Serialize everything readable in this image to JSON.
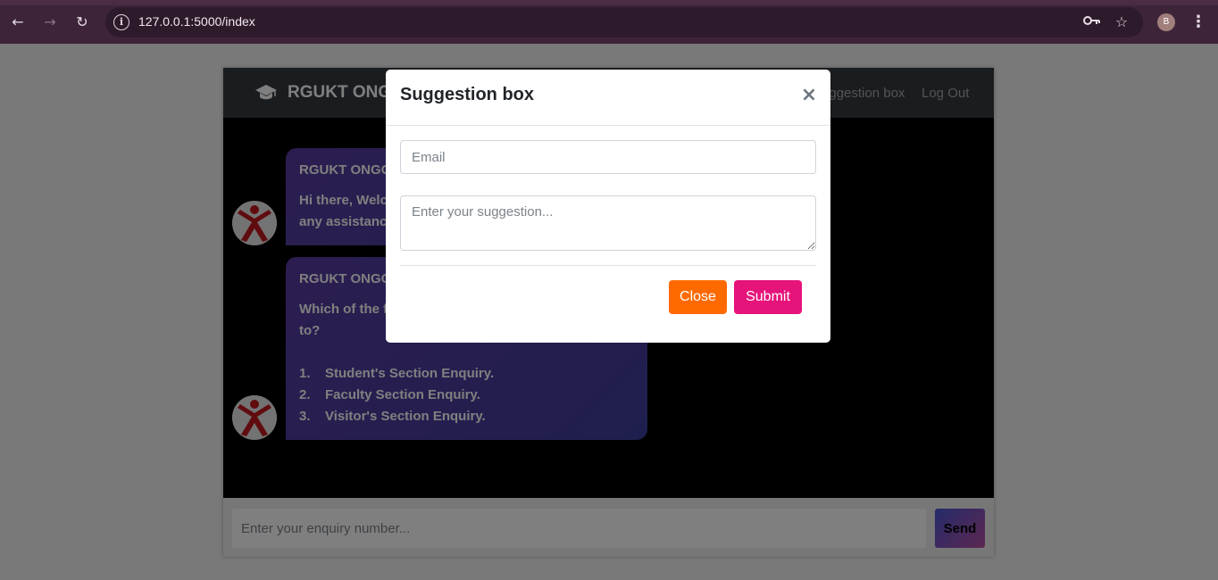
{
  "browser": {
    "url": "127.0.0.1:5000/index",
    "profile_initial": "B",
    "icons": [
      "back-icon",
      "forward-icon",
      "reload-icon",
      "info-icon",
      "key-icon",
      "star-icon",
      "kebab-menu-icon"
    ]
  },
  "navbar": {
    "brand_icon": "graduation-cap-icon",
    "brand": "RGUKT ONGOLE",
    "links": [
      "Suggestion box",
      "Log Out"
    ]
  },
  "chat": {
    "messages": [
      {
        "sender": "RGUKT ONGOLE",
        "text": "Hi there, Welcome to RGUKT ONGOLE! If you need any assistance, I'm always here."
      },
      {
        "sender": "RGUKT ONGOLE",
        "text": "Which of the following user groups do you belong to?",
        "options": [
          {
            "num": "1.",
            "label": "Student's Section Enquiry."
          },
          {
            "num": "2.",
            "label": "Faculty Section Enquiry."
          },
          {
            "num": "3.",
            "label": "Visitor's Section Enquiry."
          }
        ]
      }
    ]
  },
  "input_bar": {
    "placeholder": "Enter your enquiry number...",
    "send_label": "Send"
  },
  "modal": {
    "title": "Suggestion box",
    "close_symbol": "×",
    "email_placeholder": "Email",
    "suggestion_placeholder": "Enter your suggestion...",
    "close_label": "Close",
    "submit_label": "Submit"
  },
  "colors": {
    "browser_bar": "#3d2438",
    "navbar": "#343a40",
    "close_button": "#ff6a00",
    "submit_button": "#e6137a",
    "bubble_start": "#5a3ba0",
    "bubble_end": "#3e3e9e"
  }
}
